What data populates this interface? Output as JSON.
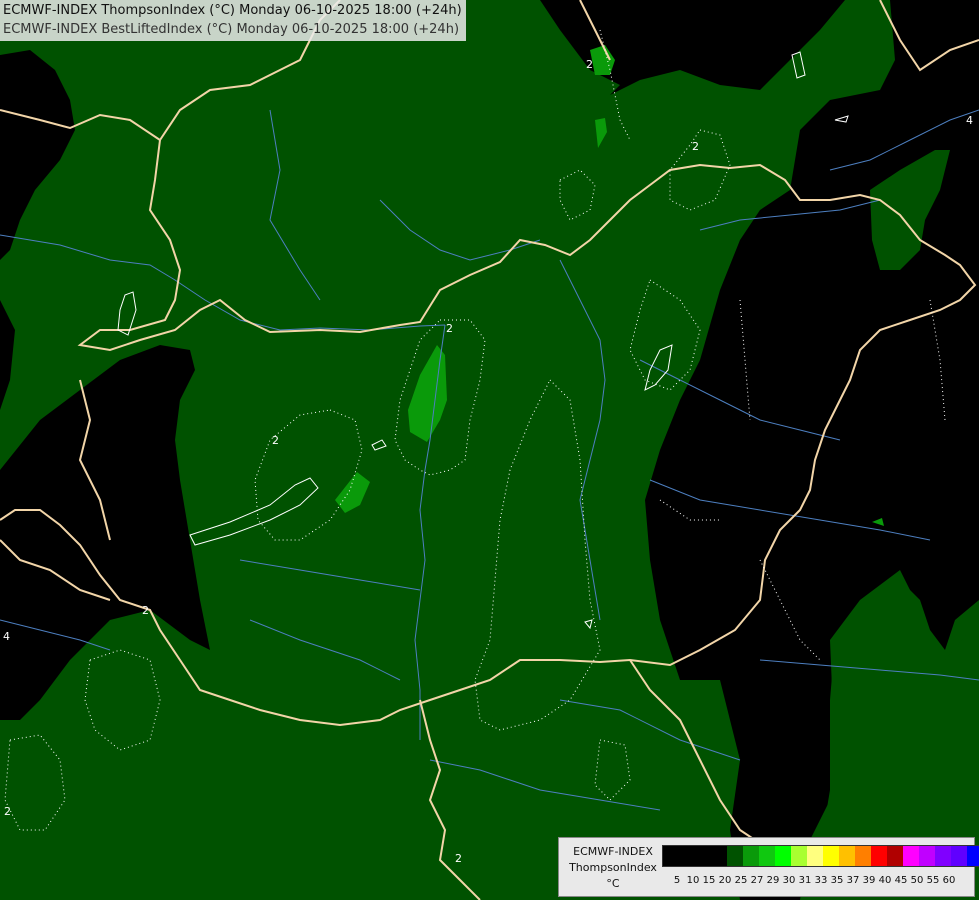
{
  "title": {
    "line1": "ECMWF-INDEX ThompsonIndex (°C) Monday 06-10-2025 18:00 (+24h)",
    "line2": "ECMWF-INDEX BestLiftedIndex (°C) Monday 06-10-2025 18:00 (+24h)"
  },
  "legend": {
    "line1": "ECMWF-INDEX",
    "line2": "ThompsonIndex",
    "unit": "°C",
    "ticks": [
      "5",
      "10",
      "15",
      "20",
      "25",
      "27",
      "29",
      "30",
      "31",
      "33",
      "35",
      "37",
      "39",
      "40",
      "45",
      "50",
      "55",
      "60"
    ],
    "colors": [
      "#000000",
      "#000000",
      "#000000",
      "#000000",
      "#005200",
      "#0a9a0a",
      "#10c810",
      "#00ff00",
      "#a8ff30",
      "#ffff7f",
      "#ffff00",
      "#ffc000",
      "#ff7f00",
      "#ff0000",
      "#b00000",
      "#ff00ff",
      "#c000ff",
      "#8000ff",
      "#6000ff",
      "#0000ff"
    ]
  },
  "contour_labels": [
    "2",
    "2",
    "2",
    "2",
    "2",
    "2",
    "2",
    "4",
    "4"
  ],
  "colors": {
    "dark_region": "#000000",
    "index_low": "#005200",
    "index_mid": "#0a9a0a",
    "border": "#f2d5a8",
    "river": "#4d7fc0"
  }
}
